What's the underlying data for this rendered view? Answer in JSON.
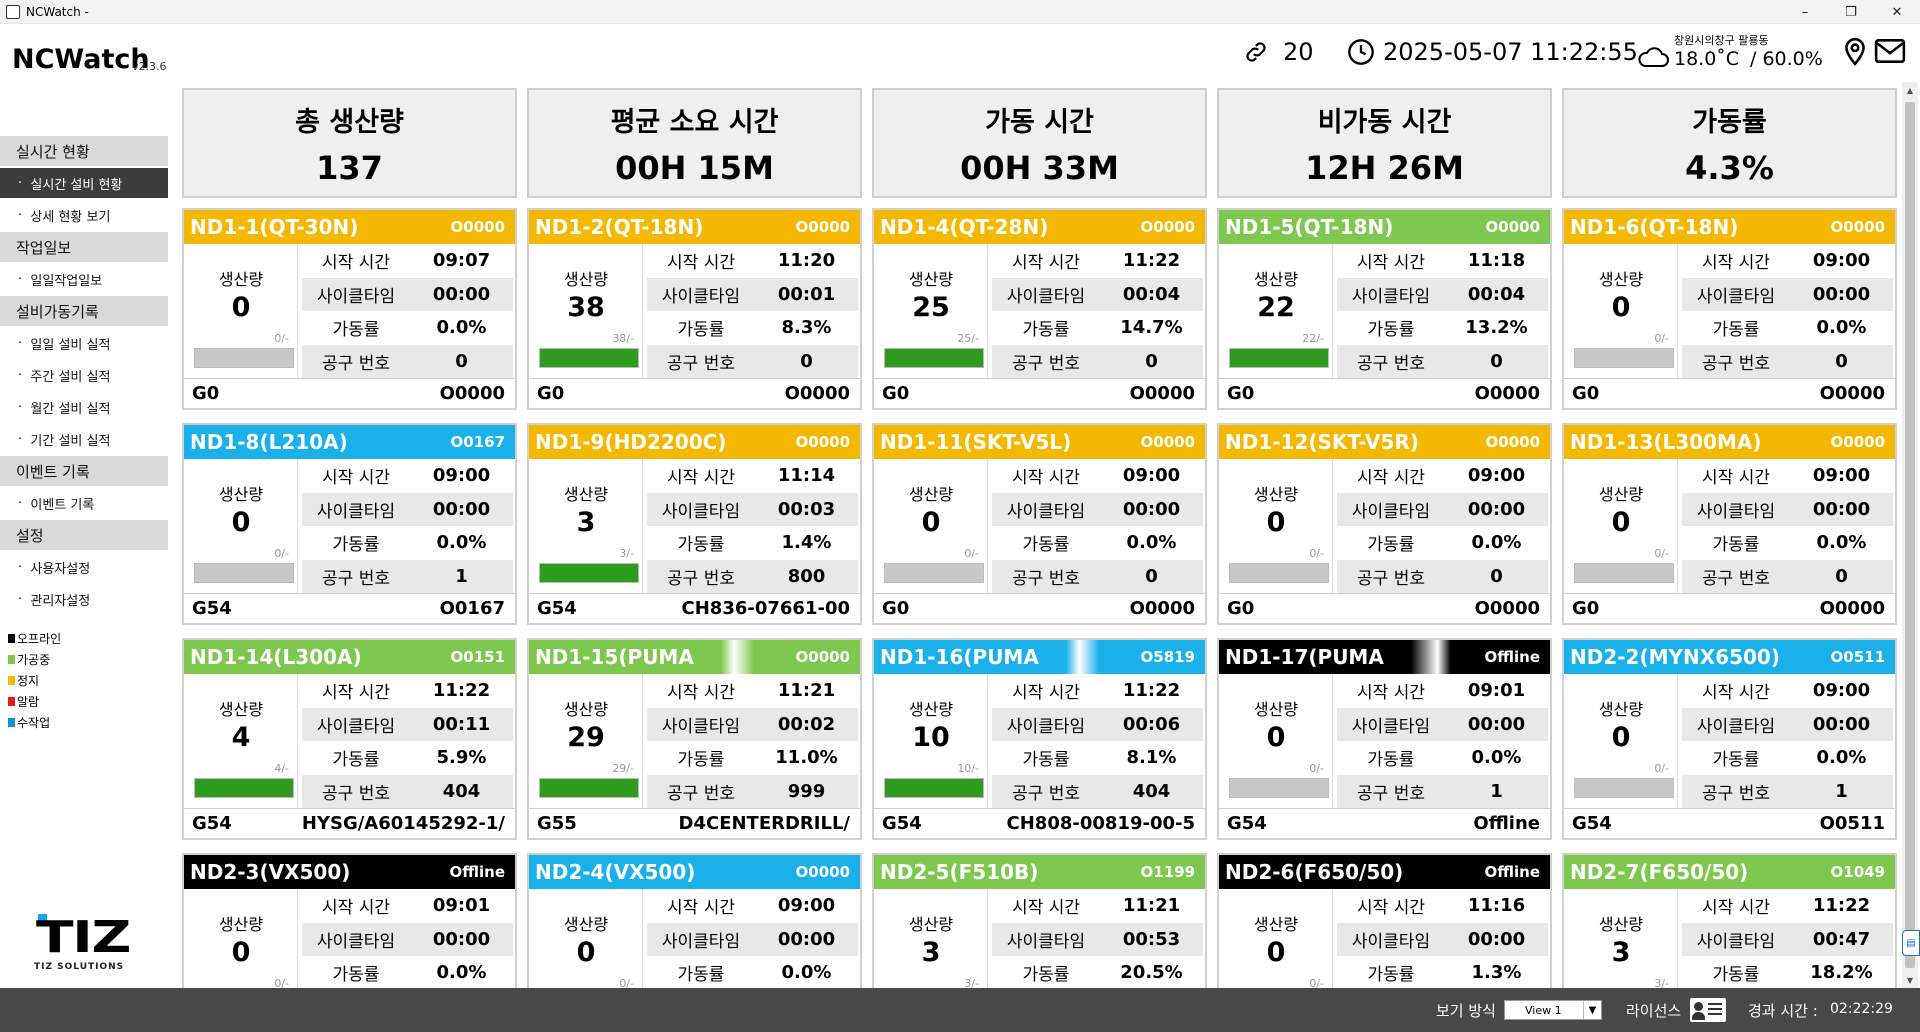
{
  "window": {
    "title": "NCWatch -",
    "min": "–",
    "max": "❐",
    "close": "✕"
  },
  "header": {
    "app_name": "NCWatch",
    "version": "v2.3.6",
    "connections": "20",
    "datetime": "2025-05-07 11:22:55",
    "location": "창원시의창구 팔룡동",
    "temperature": "18.0˚C",
    "humidity": "/ 60.0%"
  },
  "sidebar": {
    "groups": [
      {
        "label": "실시간 현황",
        "items": [
          "실시간 설비 현황",
          "상세 현황 보기"
        ]
      },
      {
        "label": "작업일보",
        "items": [
          "일일작업일보"
        ]
      },
      {
        "label": "설비가동기록",
        "items": [
          "일일 설비 실적",
          "주간 설비 실적",
          "월간 설비 실적",
          "기간 설비 실적"
        ]
      },
      {
        "label": "이벤트 기록",
        "items": [
          "이벤트 기록"
        ]
      },
      {
        "label": "설정",
        "items": [
          "사용자설정",
          "관리자설정"
        ]
      }
    ],
    "bullet": "·",
    "legend": [
      {
        "label": "오프라인",
        "color": "#000000"
      },
      {
        "label": "가공중",
        "color": "#7ec850"
      },
      {
        "label": "정지",
        "color": "#f5b800"
      },
      {
        "label": "알람",
        "color": "#e81818"
      },
      {
        "label": "수작업",
        "color": "#1a8fe0"
      }
    ],
    "brand_mark": "TIZ",
    "brand_text": "TIZ SOLUTIONS"
  },
  "summary": [
    {
      "label": "총 생산량",
      "value": "137"
    },
    {
      "label": "평균 소요 시간",
      "value": "00H 15M"
    },
    {
      "label": "가동 시간",
      "value": "00H 33M"
    },
    {
      "label": "비가동 시간",
      "value": "12H 26M"
    },
    {
      "label": "가동률",
      "value": "4.3%"
    }
  ],
  "labels": {
    "production": "생산량",
    "start_time": "시작 시간",
    "cycle_time": "사이클타임",
    "utilization": "가동률",
    "tool_no": "공구 번호"
  },
  "machines": [
    {
      "name": "ND1-1(QT-30N)",
      "program": "O0000",
      "status": "yellow",
      "count": "0",
      "ratio": "0/-",
      "fill": 0,
      "start": "09:07",
      "cycle": "00:00",
      "util": "0.0%",
      "tool": "0",
      "gcode": "G0",
      "part": "O0000"
    },
    {
      "name": "ND1-2(QT-18N)",
      "program": "O0000",
      "status": "yellow",
      "count": "38",
      "ratio": "38/-",
      "fill": 1,
      "start": "11:20",
      "cycle": "00:01",
      "util": "8.3%",
      "tool": "0",
      "gcode": "G0",
      "part": "O0000"
    },
    {
      "name": "ND1-4(QT-28N)",
      "program": "O0000",
      "status": "yellow",
      "count": "25",
      "ratio": "25/-",
      "fill": 1,
      "start": "11:22",
      "cycle": "00:04",
      "util": "14.7%",
      "tool": "0",
      "gcode": "G0",
      "part": "O0000"
    },
    {
      "name": "ND1-5(QT-18N)",
      "program": "O0000",
      "status": "green",
      "count": "22",
      "ratio": "22/-",
      "fill": 1,
      "start": "11:18",
      "cycle": "00:04",
      "util": "13.2%",
      "tool": "0",
      "gcode": "G0",
      "part": "O0000"
    },
    {
      "name": "ND1-6(QT-18N)",
      "program": "O0000",
      "status": "yellow",
      "count": "0",
      "ratio": "0/-",
      "fill": 0,
      "start": "09:00",
      "cycle": "00:00",
      "util": "0.0%",
      "tool": "0",
      "gcode": "G0",
      "part": "O0000"
    },
    {
      "name": "ND1-8(L210A)",
      "program": "O0167",
      "status": "blue",
      "count": "0",
      "ratio": "0/-",
      "fill": 0,
      "start": "09:00",
      "cycle": "00:00",
      "util": "0.0%",
      "tool": "1",
      "gcode": "G54",
      "part": "O0167"
    },
    {
      "name": "ND1-9(HD2200C)",
      "program": "O0000",
      "status": "yellow",
      "count": "3",
      "ratio": "3/-",
      "fill": 1,
      "start": "11:14",
      "cycle": "00:03",
      "util": "1.4%",
      "tool": "800",
      "gcode": "G54",
      "part": "CH836-07661-00"
    },
    {
      "name": "ND1-11(SKT-V5L)",
      "program": "O0000",
      "status": "yellow",
      "count": "0",
      "ratio": "0/-",
      "fill": 0,
      "start": "09:00",
      "cycle": "00:00",
      "util": "0.0%",
      "tool": "0",
      "gcode": "G0",
      "part": "O0000"
    },
    {
      "name": "ND1-12(SKT-V5R)",
      "program": "O0000",
      "status": "yellow",
      "count": "0",
      "ratio": "0/-",
      "fill": 0,
      "start": "09:00",
      "cycle": "00:00",
      "util": "0.0%",
      "tool": "0",
      "gcode": "G0",
      "part": "O0000"
    },
    {
      "name": "ND1-13(L300MA)",
      "program": "O0000",
      "status": "yellow",
      "count": "0",
      "ratio": "0/-",
      "fill": 0,
      "start": "09:00",
      "cycle": "00:00",
      "util": "0.0%",
      "tool": "0",
      "gcode": "G0",
      "part": "O0000"
    },
    {
      "name": "ND1-14(L300A)",
      "program": "O0151",
      "status": "green",
      "count": "4",
      "ratio": "4/-",
      "fill": 1,
      "start": "11:22",
      "cycle": "00:11",
      "util": "5.9%",
      "tool": "404",
      "gcode": "G54",
      "part": "HYSG/A60145292-1/"
    },
    {
      "name": "ND1-15(PUMA",
      "program": "O0000",
      "status": "green-grad",
      "count": "29",
      "ratio": "29/-",
      "fill": 1,
      "start": "11:21",
      "cycle": "00:02",
      "util": "11.0%",
      "tool": "999",
      "gcode": "G55",
      "part": "D4CENTERDRILL/"
    },
    {
      "name": "ND1-16(PUMA",
      "program": "O5819",
      "status": "blue-grad",
      "count": "10",
      "ratio": "10/-",
      "fill": 1,
      "start": "11:22",
      "cycle": "00:06",
      "util": "8.1%",
      "tool": "404",
      "gcode": "G54",
      "part": "CH808-00819-00-5"
    },
    {
      "name": "ND1-17(PUMA",
      "program": "Offline",
      "status": "black-grad",
      "count": "0",
      "ratio": "0/-",
      "fill": 0,
      "start": "09:01",
      "cycle": "00:00",
      "util": "0.0%",
      "tool": "1",
      "gcode": "G54",
      "part": "Offline"
    },
    {
      "name": "ND2-2(MYNX6500)",
      "program": "O0511",
      "status": "blue",
      "count": "0",
      "ratio": "0/-",
      "fill": 0,
      "start": "09:00",
      "cycle": "00:00",
      "util": "0.0%",
      "tool": "1",
      "gcode": "G54",
      "part": "O0511"
    },
    {
      "name": "ND2-3(VX500)",
      "program": "Offline",
      "status": "black",
      "count": "0",
      "ratio": "0/-",
      "fill": 0,
      "start": "09:01",
      "cycle": "00:00",
      "util": "0.0%",
      "tool": "",
      "gcode": "",
      "part": ""
    },
    {
      "name": "ND2-4(VX500)",
      "program": "O0000",
      "status": "blue",
      "count": "0",
      "ratio": "0/-",
      "fill": 0,
      "start": "09:00",
      "cycle": "00:00",
      "util": "0.0%",
      "tool": "",
      "gcode": "",
      "part": ""
    },
    {
      "name": "ND2-5(F510B)",
      "program": "O1199",
      "status": "green",
      "count": "3",
      "ratio": "3/-",
      "fill": 1,
      "start": "11:21",
      "cycle": "00:53",
      "util": "20.5%",
      "tool": "",
      "gcode": "",
      "part": ""
    },
    {
      "name": "ND2-6(F650/50)",
      "program": "Offline",
      "status": "black",
      "count": "0",
      "ratio": "0/-",
      "fill": 0,
      "start": "11:16",
      "cycle": "00:00",
      "util": "1.3%",
      "tool": "",
      "gcode": "",
      "part": ""
    },
    {
      "name": "ND2-7(F650/50)",
      "program": "O1049",
      "status": "green",
      "count": "3",
      "ratio": "3/-",
      "fill": 1,
      "start": "11:22",
      "cycle": "00:47",
      "util": "18.2%",
      "tool": "",
      "gcode": "",
      "part": ""
    }
  ],
  "statusbar": {
    "view_label": "보기 방식",
    "view_value": "View 1",
    "license_label": "라이선스",
    "elapsed_label": "경과 시간 :",
    "elapsed_value": "02:22:29"
  }
}
